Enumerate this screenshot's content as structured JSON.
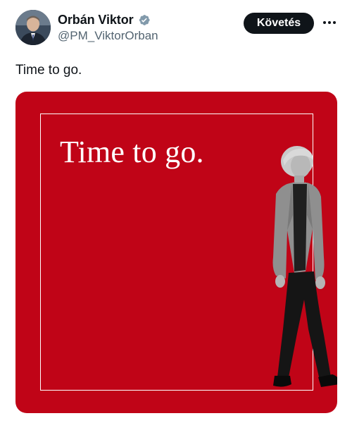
{
  "author": {
    "display_name": "Orbán Viktor",
    "handle": "@PM_ViktorOrban",
    "verified": true,
    "avatar_icon": "person-avatar"
  },
  "actions": {
    "follow_label": "Követés",
    "more_icon": "more-dots-icon"
  },
  "tweet": {
    "text": "Time to go."
  },
  "media": {
    "background_color": "#c00417",
    "frame_color": "#ffffff",
    "headline": "Time to go.",
    "subject": "walking-woman-photo"
  }
}
